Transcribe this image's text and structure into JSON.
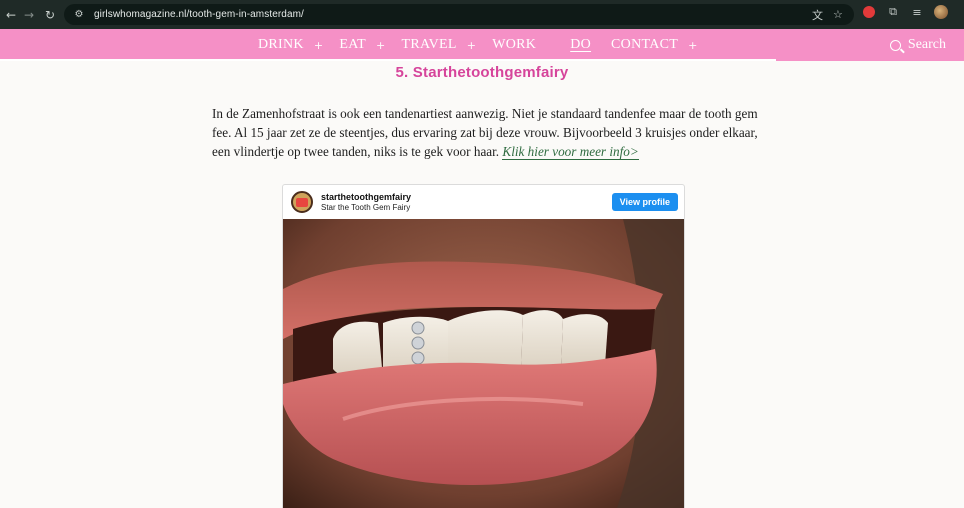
{
  "browser": {
    "back_icon": "arrow-left-icon",
    "forward_icon": "arrow-right-icon",
    "reload_icon": "reload-icon",
    "url": "girlswhomagazine.nl/tooth-gem-in-amsterdam/"
  },
  "nav": {
    "items": [
      {
        "label": "DRINK",
        "plus": "+"
      },
      {
        "label": "EAT",
        "plus": "+"
      },
      {
        "label": "TRAVEL",
        "plus": "+"
      },
      {
        "label": "WORK"
      },
      {
        "label": "DO"
      },
      {
        "label": "CONTACT",
        "plus": "+"
      }
    ],
    "search_label": "Search",
    "active": "DO"
  },
  "article": {
    "heading": "5. Starthetoothgemfairy",
    "paragraph": "In de Zamenhofstraat is ook een tandenartiest aanwezig. Niet je standaard tandenfee maar de tooth gem fee. Al 15 jaar zet ze de steentjes, dus ervaring zat bij deze vrouw. Bijvoorbeeld 3 kruisjes onder elkaar, een vlindertje op twee tanden, niks is te gek voor haar.",
    "link_text": "Klik hier voor meer info>"
  },
  "embed": {
    "username": "starthetoothgemfairy",
    "full_name": "Star the Tooth Gem Fairy",
    "view_profile": "View profile"
  },
  "colors": {
    "nav_bg": "#f590c6",
    "heading": "#d6449b",
    "link": "#2e6b3f",
    "button": "#1c8ff0"
  }
}
